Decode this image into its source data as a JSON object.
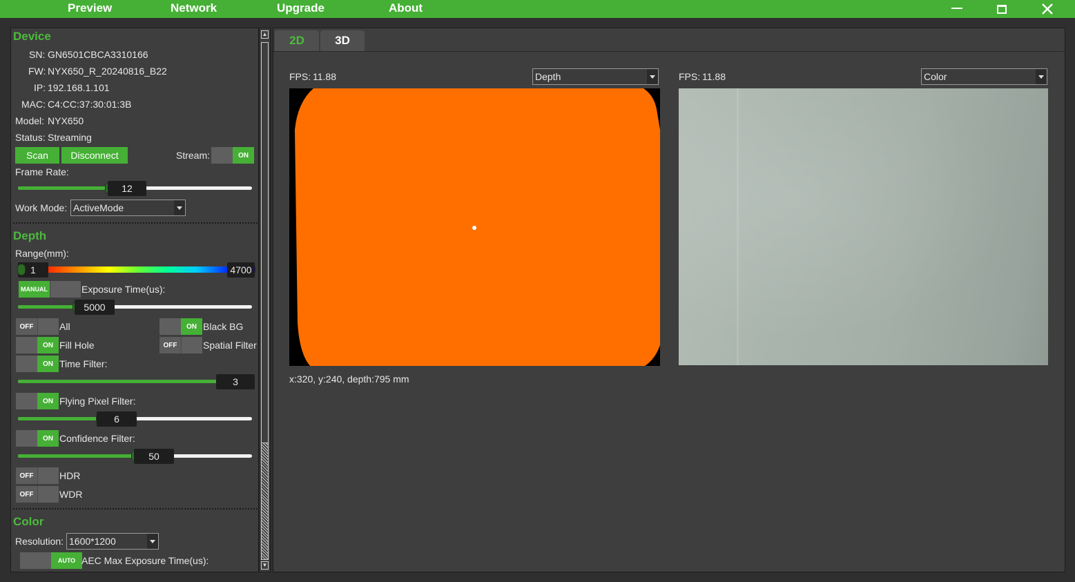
{
  "menu": {
    "preview": "Preview",
    "network": "Network",
    "upgrade": "Upgrade",
    "about": "About"
  },
  "window": {
    "minimize_icon": "minimize-icon",
    "maximize_icon": "maximize-icon",
    "close_icon": "close-icon"
  },
  "device": {
    "title": "Device",
    "sn_label": "SN:",
    "sn": "GN6501CBCA3310166",
    "fw_label": "FW:",
    "fw": "NYX650_R_20240816_B22",
    "ip_label": "IP:",
    "ip": "192.168.1.101",
    "mac_label": "MAC:",
    "mac": "C4:CC:37:30:01:3B",
    "model_label": "Model:",
    "model": "NYX650",
    "status_label": "Status:",
    "status": "Streaming",
    "scan": "Scan",
    "disconnect": "Disconnect",
    "stream_label": "Stream:",
    "stream_toggle": "ON",
    "frame_rate_label": "Frame Rate:",
    "frame_rate": "12",
    "frame_rate_fraction": 0.39,
    "work_mode_label": "Work Mode:",
    "work_mode": "ActiveMode"
  },
  "depth": {
    "title": "Depth",
    "range_label": "Range(mm):",
    "range_min": "1",
    "range_max": "4700",
    "exposure_mode": "MANUAL",
    "exposure_label": "Exposure Time(us):",
    "exposure": "5000",
    "exposure_fraction": 0.25,
    "all_toggle": "OFF",
    "all_label": "All",
    "black_bg_toggle": "ON",
    "black_bg_label": "Black BG",
    "fill_hole_toggle": "ON",
    "fill_hole_label": "Fill Hole",
    "spatial_toggle": "OFF",
    "spatial_label": "Spatial Filter",
    "time_filter_toggle": "ON",
    "time_filter_label": "Time Filter:",
    "time_filter": "3",
    "time_filter_fraction": 1.0,
    "flying_toggle": "ON",
    "flying_label": "Flying Pixel Filter:",
    "flying": "6",
    "flying_fraction": 0.35,
    "confidence_toggle": "ON",
    "confidence_label": "Confidence Filter:",
    "confidence": "50",
    "confidence_fraction": 0.5,
    "hdr_toggle": "OFF",
    "hdr_label": "HDR",
    "wdr_toggle": "OFF",
    "wdr_label": "WDR"
  },
  "color": {
    "title": "Color",
    "resolution_label": "Resolution:",
    "resolution": "1600*1200",
    "aec_toggle": "AUTO",
    "aec_label": "AEC Max Exposure Time(us):"
  },
  "tabs": {
    "tab_2d": "2D",
    "tab_3d": "3D"
  },
  "view_left": {
    "fps_label": "FPS:",
    "fps": "11.88",
    "mode": "Depth",
    "readout": "x:320, y:240, depth:795 mm"
  },
  "view_right": {
    "fps_label": "FPS:",
    "fps": "11.88",
    "mode": "Color"
  },
  "colors": {
    "accent": "#45b035",
    "depth_orange": "#ff6f00",
    "color_image": "#a9b4ad"
  }
}
